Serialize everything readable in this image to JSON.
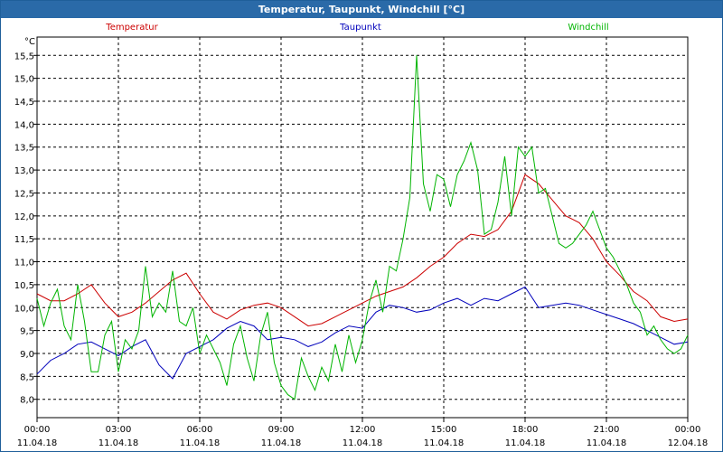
{
  "window": {
    "title": "Temperatur, Taupunkt, Windchill [°C]"
  },
  "chart_data": {
    "type": "line",
    "title": "Temperatur, Taupunkt, Windchill [°C]",
    "ylabel": "°C",
    "ylim": [
      7.6,
      15.9
    ],
    "xlim": [
      0,
      24
    ],
    "grid": true,
    "legend_position": "top",
    "y_ticks": [
      "8.0",
      "8.5",
      "9.0",
      "9.5",
      "10.0",
      "10.5",
      "11.0",
      "11.5",
      "12.0",
      "12.5",
      "13.0",
      "13.5",
      "14.0",
      "14.5",
      "15.0",
      "15.5"
    ],
    "y_tick_labels": [
      "8,0",
      "8,5",
      "9,0",
      "9,5",
      "10,0",
      "10,5",
      "11,0",
      "11,5",
      "12,0",
      "12,5",
      "13,0",
      "13,5",
      "14,0",
      "14,5",
      "15,0",
      "15,5"
    ],
    "x_ticks": [
      0,
      3,
      6,
      9,
      12,
      15,
      18,
      21,
      24
    ],
    "x_tick_labels": [
      {
        "time": "00:00",
        "date": "11.04.18"
      },
      {
        "time": "03:00",
        "date": "11.04.18"
      },
      {
        "time": "06:00",
        "date": "11.04.18"
      },
      {
        "time": "09:00",
        "date": "11.04.18"
      },
      {
        "time": "12:00",
        "date": "11.04.18"
      },
      {
        "time": "15:00",
        "date": "11.04.18"
      },
      {
        "time": "18:00",
        "date": "11.04.18"
      },
      {
        "time": "21:00",
        "date": "11.04.18"
      },
      {
        "time": "00:00",
        "date": "12.04.18"
      }
    ],
    "series": [
      {
        "name": "Temperatur",
        "color": "#cc0000",
        "x": [
          0,
          0.5,
          1,
          1.5,
          2,
          2.5,
          3,
          3.5,
          4,
          4.5,
          5,
          5.5,
          6,
          6.5,
          7,
          7.5,
          8,
          8.5,
          9,
          9.5,
          10,
          10.5,
          11,
          11.5,
          12,
          12.5,
          13,
          13.5,
          14,
          14.5,
          15,
          15.5,
          16,
          16.5,
          17,
          17.5,
          18,
          18.5,
          19,
          19.5,
          20,
          20.5,
          21,
          21.5,
          22,
          22.5,
          23,
          23.5,
          24
        ],
        "values": [
          10.3,
          10.15,
          10.15,
          10.3,
          10.5,
          10.1,
          9.8,
          9.9,
          10.1,
          10.35,
          10.6,
          10.75,
          10.3,
          9.9,
          9.75,
          9.95,
          10.05,
          10.1,
          10.0,
          9.8,
          9.6,
          9.65,
          9.8,
          9.95,
          10.1,
          10.25,
          10.35,
          10.45,
          10.65,
          10.9,
          11.1,
          11.4,
          11.6,
          11.55,
          11.7,
          12.1,
          12.9,
          12.7,
          12.35,
          12.0,
          11.85,
          11.5,
          11.0,
          10.7,
          10.35,
          10.15,
          9.8,
          9.7,
          9.75
        ]
      },
      {
        "name": "Taupunkt",
        "color": "#0000bb",
        "x": [
          0,
          0.5,
          1,
          1.5,
          2,
          2.5,
          3,
          3.5,
          4,
          4.5,
          5,
          5.5,
          6,
          6.5,
          7,
          7.5,
          8,
          8.5,
          9,
          9.5,
          10,
          10.5,
          11,
          11.5,
          12,
          12.5,
          13,
          13.5,
          14,
          14.5,
          15,
          15.5,
          16,
          16.5,
          17,
          17.5,
          18,
          18.5,
          19,
          19.5,
          20,
          20.5,
          21,
          21.5,
          22,
          22.5,
          23,
          23.5,
          24
        ],
        "values": [
          8.55,
          8.85,
          9.0,
          9.2,
          9.25,
          9.1,
          8.95,
          9.15,
          9.3,
          8.75,
          8.45,
          9.0,
          9.15,
          9.3,
          9.55,
          9.7,
          9.6,
          9.3,
          9.35,
          9.3,
          9.15,
          9.25,
          9.45,
          9.6,
          9.55,
          9.9,
          10.05,
          10.0,
          9.9,
          9.95,
          10.1,
          10.2,
          10.05,
          10.2,
          10.15,
          10.3,
          10.45,
          10.0,
          10.05,
          10.1,
          10.05,
          9.95,
          9.85,
          9.75,
          9.65,
          9.5,
          9.35,
          9.2,
          9.25
        ]
      },
      {
        "name": "Windchill",
        "color": "#00b400",
        "x": [
          0,
          0.25,
          0.5,
          0.75,
          1,
          1.25,
          1.5,
          1.75,
          2,
          2.25,
          2.5,
          2.75,
          3,
          3.25,
          3.5,
          3.75,
          4,
          4.25,
          4.5,
          4.75,
          5,
          5.25,
          5.5,
          5.75,
          6,
          6.25,
          6.5,
          6.75,
          7,
          7.25,
          7.5,
          7.75,
          8,
          8.25,
          8.5,
          8.75,
          9,
          9.25,
          9.5,
          9.75,
          10,
          10.25,
          10.5,
          10.75,
          11,
          11.25,
          11.5,
          11.75,
          12,
          12.25,
          12.5,
          12.75,
          13,
          13.25,
          13.5,
          13.75,
          14,
          14.25,
          14.5,
          14.75,
          15,
          15.25,
          15.5,
          15.75,
          16,
          16.25,
          16.5,
          16.75,
          17,
          17.25,
          17.5,
          17.75,
          18,
          18.25,
          18.5,
          18.75,
          19,
          19.25,
          19.5,
          19.75,
          20,
          20.25,
          20.5,
          20.75,
          21,
          21.25,
          21.5,
          21.75,
          22,
          22.25,
          22.5,
          22.75,
          23,
          23.25,
          23.5,
          23.75,
          24
        ],
        "values": [
          10.2,
          9.6,
          10.1,
          10.4,
          9.6,
          9.3,
          10.5,
          9.7,
          8.6,
          8.6,
          9.4,
          9.7,
          8.6,
          9.3,
          9.1,
          9.5,
          10.9,
          9.8,
          10.1,
          9.9,
          10.8,
          9.7,
          9.6,
          10.0,
          9.0,
          9.4,
          9.1,
          8.8,
          8.3,
          9.2,
          9.6,
          8.9,
          8.4,
          9.4,
          9.9,
          8.8,
          8.3,
          8.1,
          8.0,
          8.9,
          8.5,
          8.2,
          8.7,
          8.4,
          9.2,
          8.6,
          9.4,
          8.8,
          9.3,
          10.1,
          10.6,
          9.9,
          10.9,
          10.8,
          11.5,
          12.4,
          15.5,
          12.7,
          12.1,
          12.9,
          12.8,
          12.2,
          12.9,
          13.2,
          13.6,
          13.0,
          11.6,
          11.7,
          12.3,
          13.3,
          12.0,
          13.5,
          13.3,
          13.5,
          12.5,
          12.6,
          12.0,
          11.4,
          11.3,
          11.4,
          11.6,
          11.8,
          12.1,
          11.7,
          11.3,
          11.1,
          10.8,
          10.5,
          10.1,
          9.9,
          9.4,
          9.6,
          9.3,
          9.1,
          9.0,
          9.1,
          9.4
        ]
      }
    ]
  }
}
